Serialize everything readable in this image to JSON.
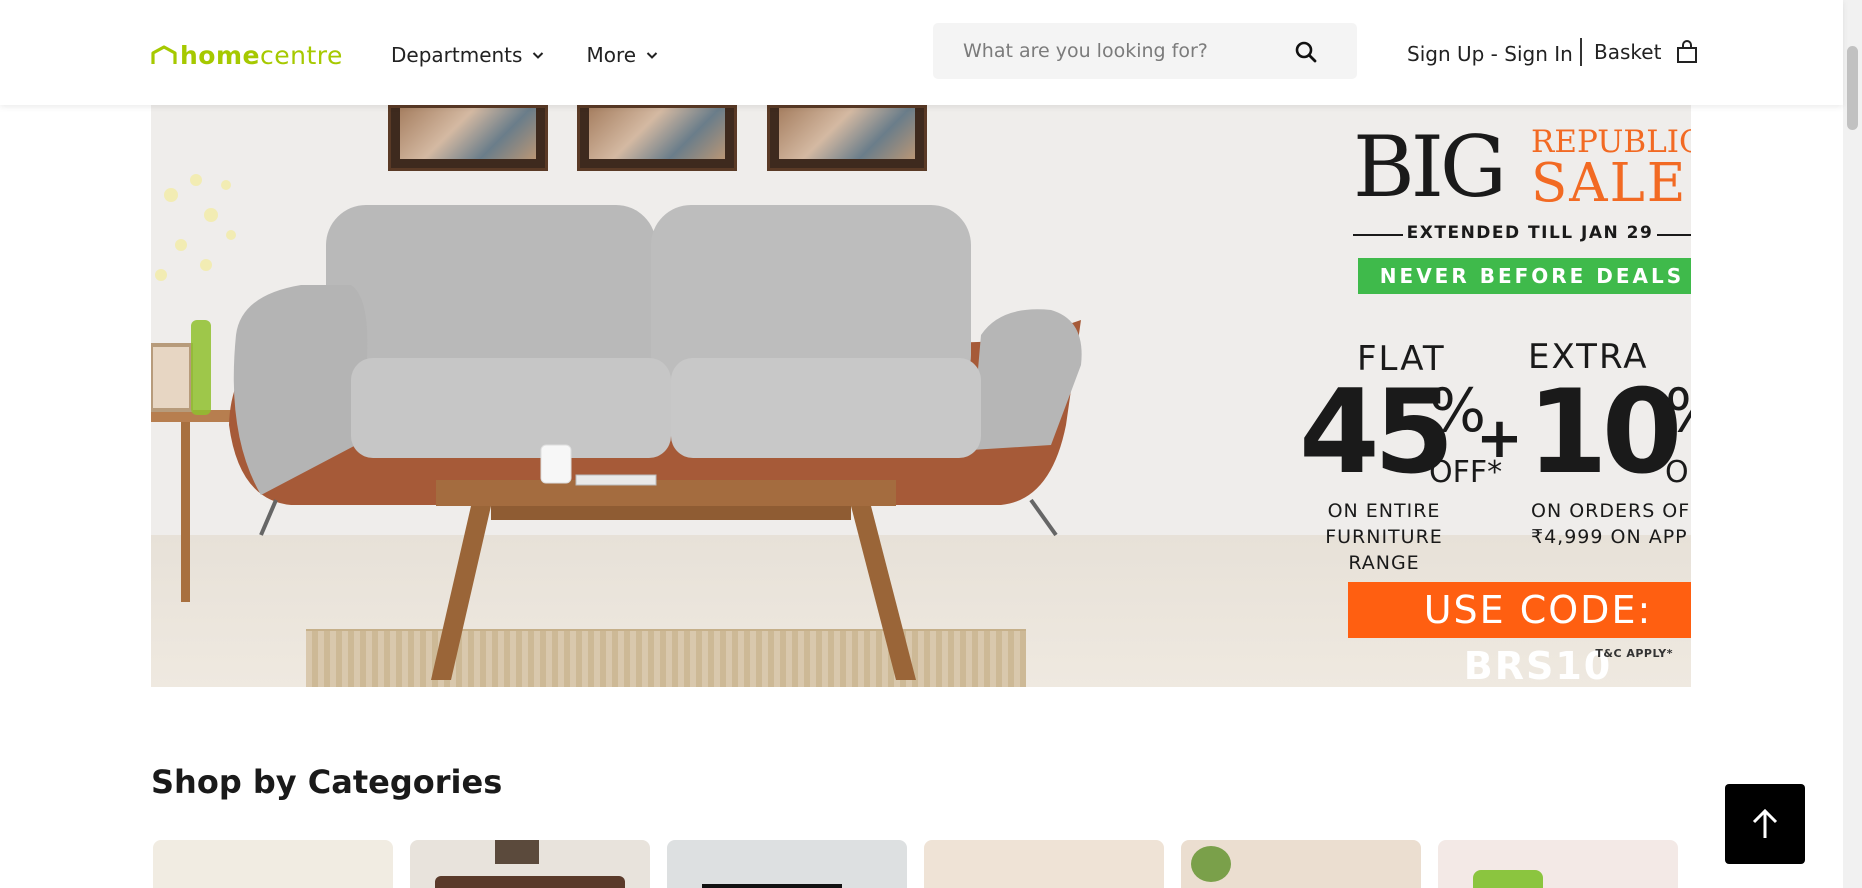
{
  "header": {
    "logo_home": "home",
    "logo_centre": "centre",
    "nav": [
      {
        "label": "Departments"
      },
      {
        "label": "More"
      }
    ],
    "search_placeholder": "What are you looking for?",
    "account_label": "Sign Up - Sign In",
    "basket_label": "Basket"
  },
  "banner": {
    "big": "BIG",
    "republic": "REPUBLIC",
    "sale": "SALE",
    "extended": "EXTENDED TILL JAN 29",
    "never": "NEVER BEFORE DEALS",
    "flat": "FLAT",
    "flat_value": "45",
    "extra": "EXTRA",
    "extra_value": "10",
    "percent": "%",
    "off": "OFF*",
    "plus": "+",
    "desc1_line1": "ON ENTIRE",
    "desc1_line2": "FURNITURE RANGE",
    "desc2_line1": "ON ORDERS OF",
    "desc2_line2": "₹4,999 ON APP",
    "code_prefix": "USE CODE: ",
    "code_value": "BRS10",
    "tnc": "T&C APPLY*"
  },
  "categories": {
    "title": "Shop by Categories",
    "items": [
      {
        "color": "#f1ece2"
      },
      {
        "color": "#e8e3dc"
      },
      {
        "color": "#dde0e1"
      },
      {
        "color": "#efe3d6"
      },
      {
        "color": "#ebded0"
      },
      {
        "color": "#f3e9e6"
      }
    ]
  },
  "colors": {
    "brand": "#a6c900",
    "accent_orange": "#f26a23",
    "code_orange": "#ff5f11",
    "deal_green": "#3fba4b"
  },
  "icons": [
    "home-logo-icon",
    "chevron-down-icon",
    "search-icon",
    "basket-icon",
    "arrow-up-icon"
  ]
}
